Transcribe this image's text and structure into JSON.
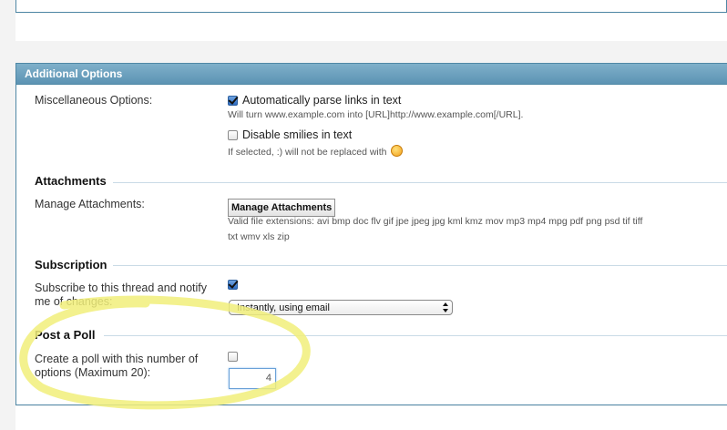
{
  "panel": {
    "header": "Additional Options"
  },
  "misc": {
    "label": "Miscellaneous Options:",
    "parse_links": {
      "label": "Automatically parse links in text",
      "checked": true,
      "help": "Will turn www.example.com into [URL]http://www.example.com[/URL]."
    },
    "disable_smilies": {
      "label": "Disable smilies in text",
      "checked": false,
      "help": "If selected, :) will not be replaced with"
    }
  },
  "attachments": {
    "title": "Attachments",
    "label": "Manage Attachments:",
    "button": "Manage Attachments",
    "extensions_line1": "Valid file extensions: avi bmp doc flv gif jpe jpeg jpg kml kmz mov mp3 mp4 mpg pdf png psd tif tiff",
    "extensions_line2": "txt wmv xls zip"
  },
  "subscription": {
    "title": "Subscription",
    "label_line1": "Subscribe to this thread and notify",
    "label_line2": "me of changes:",
    "checked": true,
    "mode": "Instantly, using email"
  },
  "poll": {
    "title": "Post a Poll",
    "label_line1": "Create a poll with this number of",
    "label_line2": "options (Maximum 20):",
    "checked": false,
    "options_value": "4"
  },
  "colors": {
    "header_bg": "#5c93b3",
    "border": "#4f88a6",
    "highlight": "#f1ef7a"
  },
  "icons": {
    "smiley": "smiley-icon",
    "select_arrows": "select-arrows-icon"
  }
}
